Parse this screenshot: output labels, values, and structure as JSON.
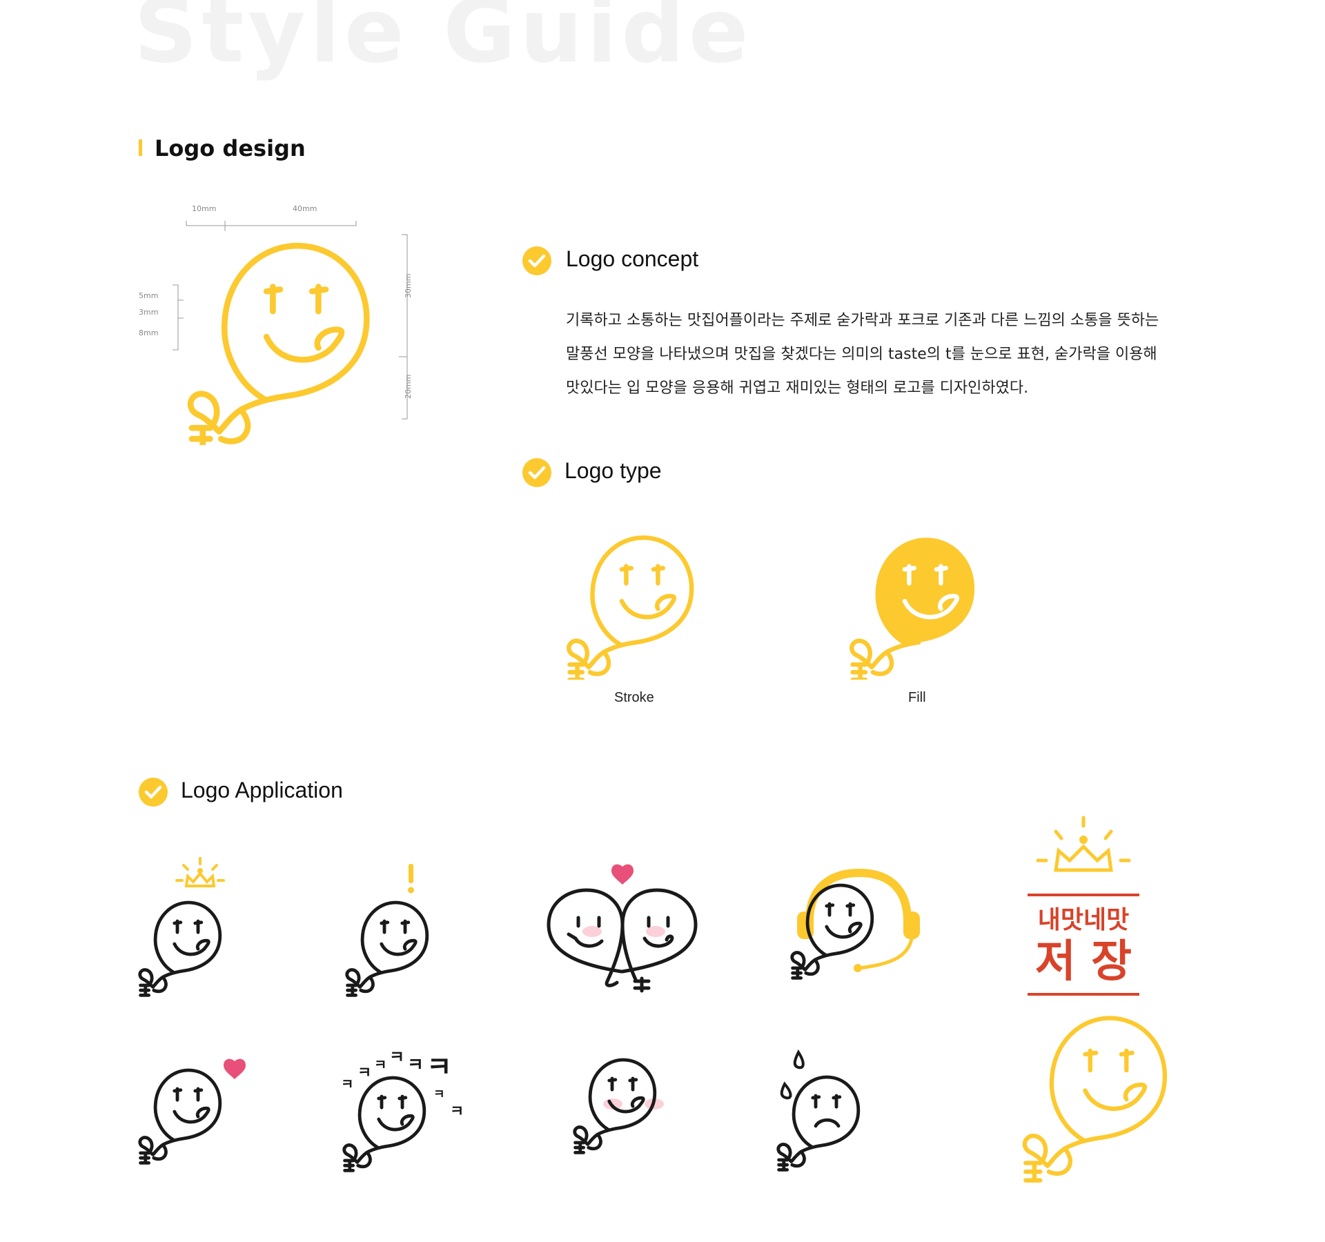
{
  "header": {
    "title": "Style Guide"
  },
  "section": {
    "title": "Logo design"
  },
  "dimensions": {
    "top_left": "10mm",
    "top_right": "40mm",
    "right_top": "30mm",
    "right_bottom": "20mm",
    "left_1": "5mm",
    "left_2": "3mm",
    "left_3": "8mm"
  },
  "concept": {
    "title": "Logo concept",
    "lines": [
      "기록하고 소통하는 맛집어플이라는 주제로 숟가락과 포크로 기존과 다른 느낌의 소통을 뜻하는",
      "말풍선 모양을 나타냈으며  맛집을 찾겠다는 의미의 taste의 t를 눈으로 표현, 숟가락을 이용해",
      "맛있다는 입 모양을 응용해 귀엽고 재미있는 형태의 로고를 디자인하였다."
    ]
  },
  "logo_type": {
    "title": "Logo type",
    "stroke_label": "Stroke",
    "fill_label": "Fill"
  },
  "application": {
    "title": "Logo Application",
    "banner_line1": "내맛네맛",
    "banner_line2": "저 장",
    "laugh_glyph": "ㅋ"
  },
  "colors": {
    "yellow": "#fcc92f",
    "black": "#1a1a1a",
    "pink": "#e8507a",
    "red": "#d8432a"
  }
}
